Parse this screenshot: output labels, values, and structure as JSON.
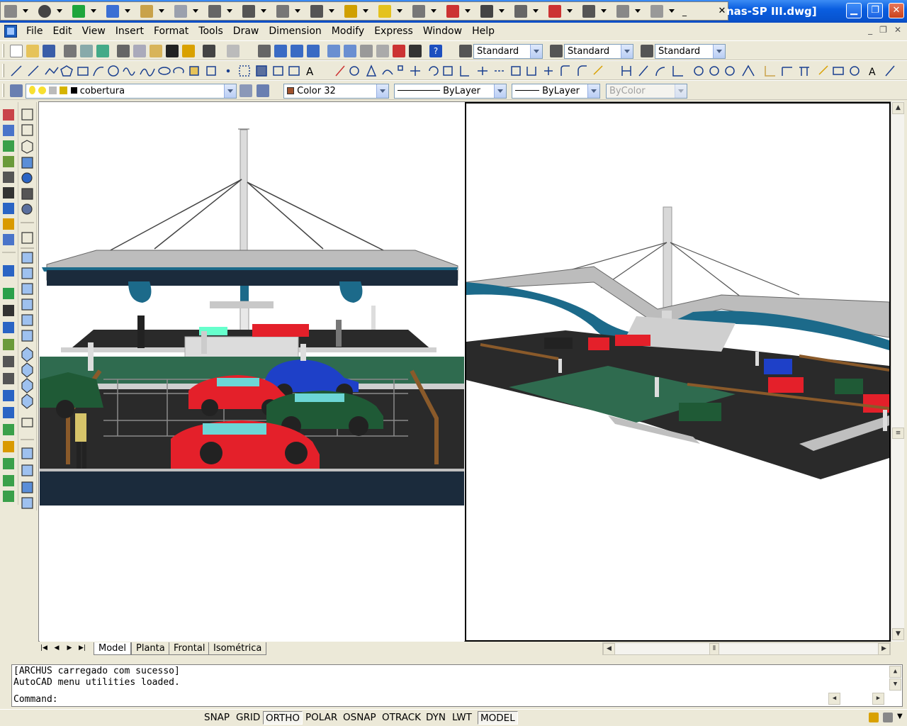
{
  "window": {
    "title": "nas-SP III.dwg]",
    "min": "▁",
    "max": "❐",
    "close": "✕"
  },
  "floating_toolbar": {
    "close": "✕"
  },
  "menu": [
    "File",
    "Edit",
    "View",
    "Insert",
    "Format",
    "Tools",
    "Draw",
    "Dimension",
    "Modify",
    "Express",
    "Window",
    "Help"
  ],
  "mdi": {
    "min": "_",
    "restore": "❐",
    "close": "✕"
  },
  "styles": {
    "text_style": "Standard",
    "dim_style": "Standard",
    "table_style": "Standard"
  },
  "layers": {
    "current_layer": "cobertura",
    "color": "Color 32",
    "color_swatch": "#a0522d",
    "linetype": "ByLayer",
    "lineweight": "ByLayer",
    "plotstyle": "ByColor"
  },
  "layout_tabs": [
    "Model",
    "Planta",
    "Frontal",
    "Isométrica"
  ],
  "command": {
    "history": [
      "[ARCHUS carregado com sucesso]",
      "AutoCAD menu utilities loaded."
    ],
    "prompt": "Command:"
  },
  "status_toggles": [
    {
      "label": "SNAP",
      "on": false
    },
    {
      "label": "GRID",
      "on": false
    },
    {
      "label": "ORTHO",
      "on": true
    },
    {
      "label": "POLAR",
      "on": false
    },
    {
      "label": "OSNAP",
      "on": false
    },
    {
      "label": "OTRACK",
      "on": false
    },
    {
      "label": "DYN",
      "on": false
    },
    {
      "label": "LWT",
      "on": false
    },
    {
      "label": "MODEL",
      "on": true
    }
  ],
  "colors": {
    "titlebar": "#0a5ee0",
    "roof_blue": "#1c6a8a",
    "lawn": "#2f6b4f",
    "pavement": "#2a2a2a",
    "car_red": "#e4202a",
    "car_green": "#1f5a36",
    "car_blue": "#1e40c8"
  }
}
